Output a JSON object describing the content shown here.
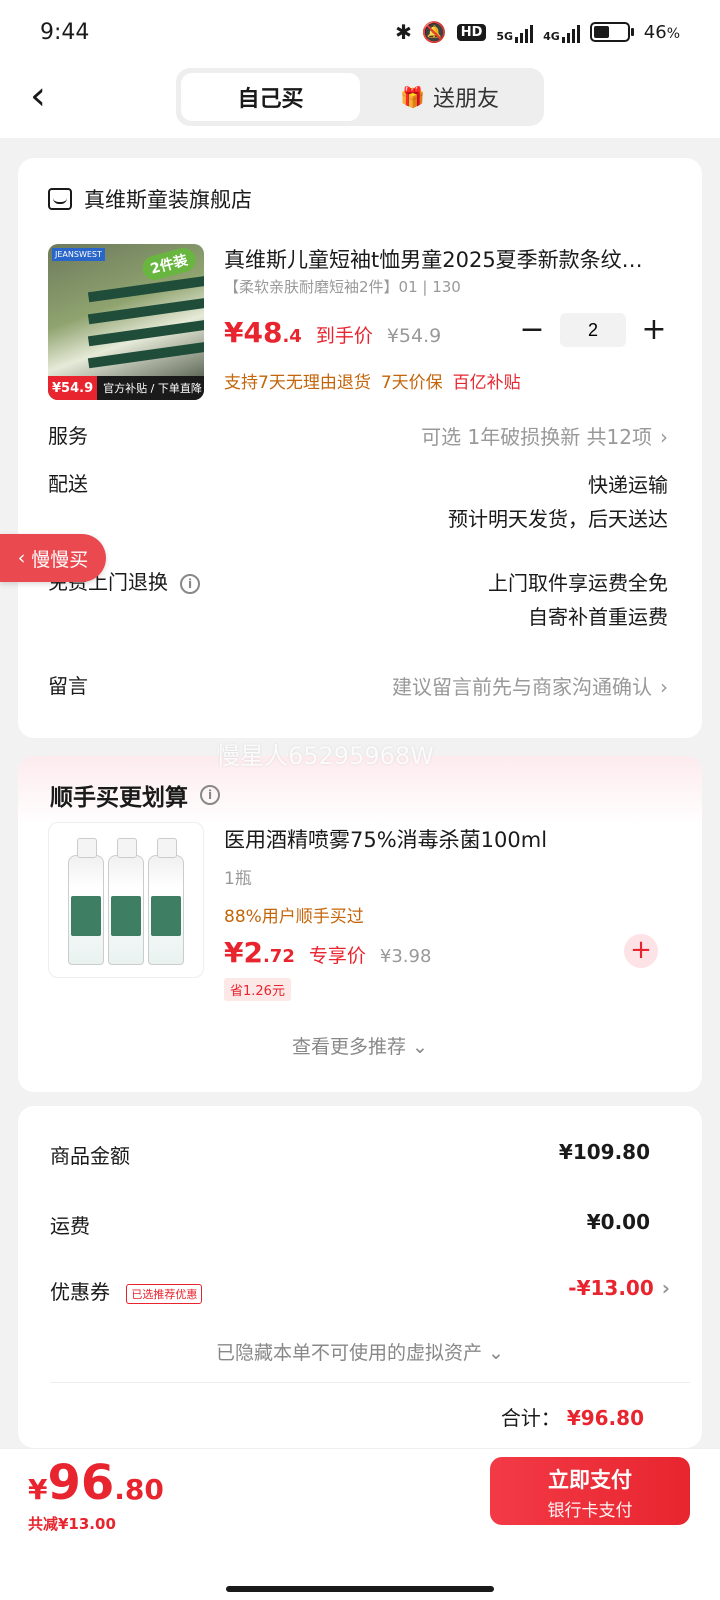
{
  "status_bar": {
    "time": "9:44",
    "hd": "HD",
    "net1": "5G",
    "net2": "4G",
    "battery": "46",
    "battery_unit": "%",
    "battery_level": 0.46
  },
  "header": {
    "back": "‹",
    "tabs": [
      {
        "label": "自己买",
        "active": true
      },
      {
        "label": "送朋友",
        "active": false
      }
    ]
  },
  "order": {
    "store_name": "真维斯童装旗舰店",
    "product": {
      "title": "真维斯儿童短袖t恤男童2025夏季新款条纹…",
      "spec": "【柔软亲肤耐磨短袖2件】01 | 130",
      "image_badge": "2件装",
      "image_brand": "JEANSWEST",
      "image_price": "¥54.9",
      "image_strip": "官方补贴 / 下单直降",
      "price_int": "¥48",
      "price_dec": ".4",
      "price_label": "到手价",
      "price_old": "¥54.9",
      "quantity": "2",
      "minus": "−",
      "plus": "+",
      "promise_1": "支持7天无理由退货",
      "promise_2": "7天价保",
      "promise_3": "百亿补贴"
    },
    "service": {
      "label": "服务",
      "value": "可选 1年破损换新 共12项"
    },
    "delivery": {
      "label": "配送",
      "line1": "快递运输",
      "line2": "预计明天发货，后天送达"
    },
    "return": {
      "label": "免费上门退换",
      "line1": "上门取件享运费全免",
      "line2": "自寄补首重运费"
    },
    "message": {
      "label": "留言",
      "placeholder": "建议留言前先与商家沟通确认"
    }
  },
  "slow_buy": "慢慢买",
  "watermark": "慢星人65295968W",
  "recommend": {
    "title": "顺手买更划算",
    "item": {
      "title": "医用酒精喷雾75%消毒杀菌100ml",
      "qty": "1瓶",
      "popularity": "88%用户顺手买过",
      "price_int": "¥2",
      "price_dec": ".72",
      "price_label": "专享价",
      "price_old": "¥3.98",
      "save": "省1.26元"
    },
    "more": "查看更多推荐 ⌄"
  },
  "summary": {
    "goods_label": "商品金额",
    "goods_value": "¥109.80",
    "shipping_label": "运费",
    "shipping_value": "¥0.00",
    "coupon_label": "优惠券",
    "coupon_tag": "已选推荐优惠",
    "coupon_value": "-¥13.00",
    "hidden_assets": "已隐藏本单不可使用的虚拟资产 ⌄",
    "total_label": "合计：",
    "total_value": "¥96.80"
  },
  "bottom": {
    "currency": "¥",
    "price_int": "96",
    "price_dec": ".80",
    "saved": "共减¥13.00",
    "pay_title": "立即支付",
    "pay_sub": "银行卡支付"
  },
  "colors": {
    "accent": "#e8252f",
    "orange": "#c4650a",
    "bg": "#f2f2f2"
  }
}
